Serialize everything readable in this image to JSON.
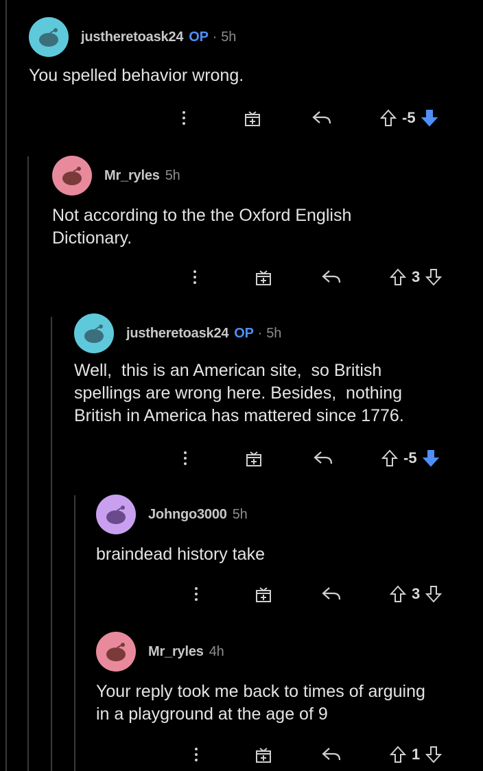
{
  "colors": {
    "background": "#000000",
    "op": "#4f8ff7",
    "downvote_active": "#4f8ff7",
    "thread_line": "#3a3a3c"
  },
  "comments": [
    {
      "username": "justheretoask24",
      "op_label": "OP",
      "separator": "·",
      "time": "5h",
      "text": "You spelled behavior wrong.",
      "score": "-5",
      "downvoted": true,
      "avatar_color": "#5fc9dc"
    },
    {
      "username": "Mr_ryles",
      "time": "5h",
      "text": "Not according to the the Oxford English\nDictionary.",
      "score": "3",
      "downvoted": false,
      "avatar_color": "#e88a9c"
    },
    {
      "username": "justheretoask24",
      "op_label": "OP",
      "separator": "·",
      "time": "5h",
      "text": "Well,  this is an American site,  so British\nspellings are wrong here. Besides,  nothing\nBritish in America has mattered since 1776.",
      "score": "-5",
      "downvoted": true,
      "avatar_color": "#5fc9dc"
    },
    {
      "username": "Johngo3000",
      "time": "5h",
      "text": "braindead history take",
      "score": "3",
      "downvoted": false,
      "avatar_color": "#c9a0f0"
    },
    {
      "username": "Mr_ryles",
      "time": "4h",
      "text": "Your reply took me back to times of arguing\nin a playground at the age of 9",
      "score": "1",
      "downvoted": false,
      "avatar_color": "#e88a9c"
    }
  ],
  "icons": {
    "more": "more-options-icon",
    "award": "award-gift-icon",
    "reply": "reply-arrow-icon",
    "upvote": "upvote-arrow-icon",
    "downvote": "downvote-arrow-icon"
  }
}
